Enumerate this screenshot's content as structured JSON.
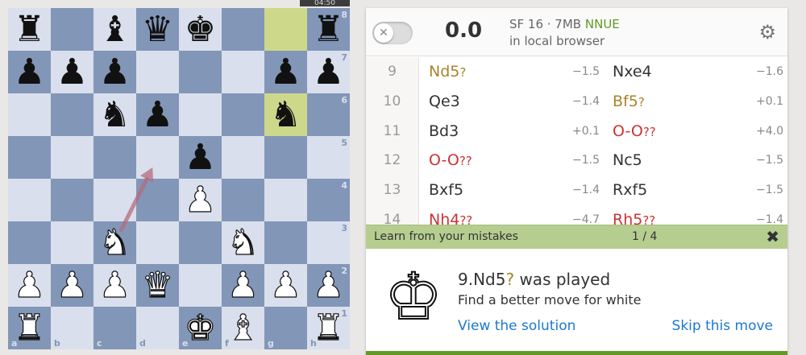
{
  "clock": "04:50",
  "board": {
    "ranks": [
      "8",
      "7",
      "6",
      "5",
      "4",
      "3",
      "2",
      "1"
    ],
    "files": [
      "a",
      "b",
      "c",
      "d",
      "e",
      "f",
      "g",
      "h"
    ],
    "highlight": [
      "g8",
      "g6"
    ],
    "pieces": {
      "a8": "bR",
      "c8": "bB",
      "d8": "bQ",
      "e8": "bK",
      "h8": "bR",
      "a7": "bP",
      "b7": "bP",
      "c7": "bP",
      "g7": "bP",
      "h7": "bP",
      "c6": "bN",
      "d6": "bP",
      "g6": "bN",
      "e5": "bP",
      "e4": "wP",
      "c3": "wN",
      "f3": "wN",
      "a2": "wP",
      "b2": "wP",
      "c2": "wP",
      "d2": "wQ",
      "f2": "wP",
      "g2": "wP",
      "h2": "wP",
      "a1": "wR",
      "e1": "wK",
      "f1": "wB",
      "h1": "wR"
    },
    "arrow": {
      "from": "c3",
      "to": "d5",
      "color": "#b56a7e"
    }
  },
  "ceval": {
    "toggle_icon": "close-icon",
    "eval": "0.0",
    "engine_name": "SF 16 · 7MB",
    "engine_tag": "NNUE",
    "engine_location": "in local browser",
    "settings_icon": "gear-icon"
  },
  "moves": [
    {
      "num": "9",
      "white": {
        "san": "Nd5",
        "glyph": "?",
        "class": "inacc",
        "eval": "−1.5"
      },
      "black": {
        "san": "Nxe4",
        "glyph": "",
        "class": "",
        "eval": "−1.6"
      }
    },
    {
      "num": "10",
      "white": {
        "san": "Qe3",
        "glyph": "",
        "class": "",
        "eval": "−1.4"
      },
      "black": {
        "san": "Bf5",
        "glyph": "?",
        "class": "inacc",
        "eval": "+0.1"
      }
    },
    {
      "num": "11",
      "white": {
        "san": "Bd3",
        "glyph": "",
        "class": "",
        "eval": "+0.1"
      },
      "black": {
        "san": "O-O",
        "glyph": "??",
        "class": "blunder",
        "eval": "+4.0"
      }
    },
    {
      "num": "12",
      "white": {
        "san": "O-O",
        "glyph": "??",
        "class": "blunder",
        "eval": "−1.5"
      },
      "black": {
        "san": "Nc5",
        "glyph": "",
        "class": "",
        "eval": "−1.5"
      }
    },
    {
      "num": "13",
      "white": {
        "san": "Bxf5",
        "glyph": "",
        "class": "",
        "eval": "−1.4"
      },
      "black": {
        "san": "Rxf5",
        "glyph": "",
        "class": "",
        "eval": "−1.5"
      }
    },
    {
      "num": "14",
      "white": {
        "san": "Nh4",
        "glyph": "??",
        "class": "blunder",
        "eval": "−4.7"
      },
      "black": {
        "san": "Rh5",
        "glyph": "??",
        "class": "blunder",
        "eval": "−1.4"
      }
    }
  ],
  "learn": {
    "title": "Learn from your mistakes",
    "progress": "1 / 4",
    "close_icon": "close-icon",
    "king_icon": "white-king-icon",
    "played_move": "9.Nd5",
    "played_glyph": "?",
    "played_suffix": " was played",
    "prompt": "Find a better move for white",
    "view_solution": "View the solution",
    "skip_move": "Skip this move"
  },
  "colors": {
    "light_square": "#d9dfec",
    "dark_square": "#8296b8",
    "highlight": "#aebf6a",
    "inaccuracy": "#a8842a",
    "blunder": "#cc3333",
    "link": "#1b78d0",
    "learn_bar": "#b6cd90"
  }
}
